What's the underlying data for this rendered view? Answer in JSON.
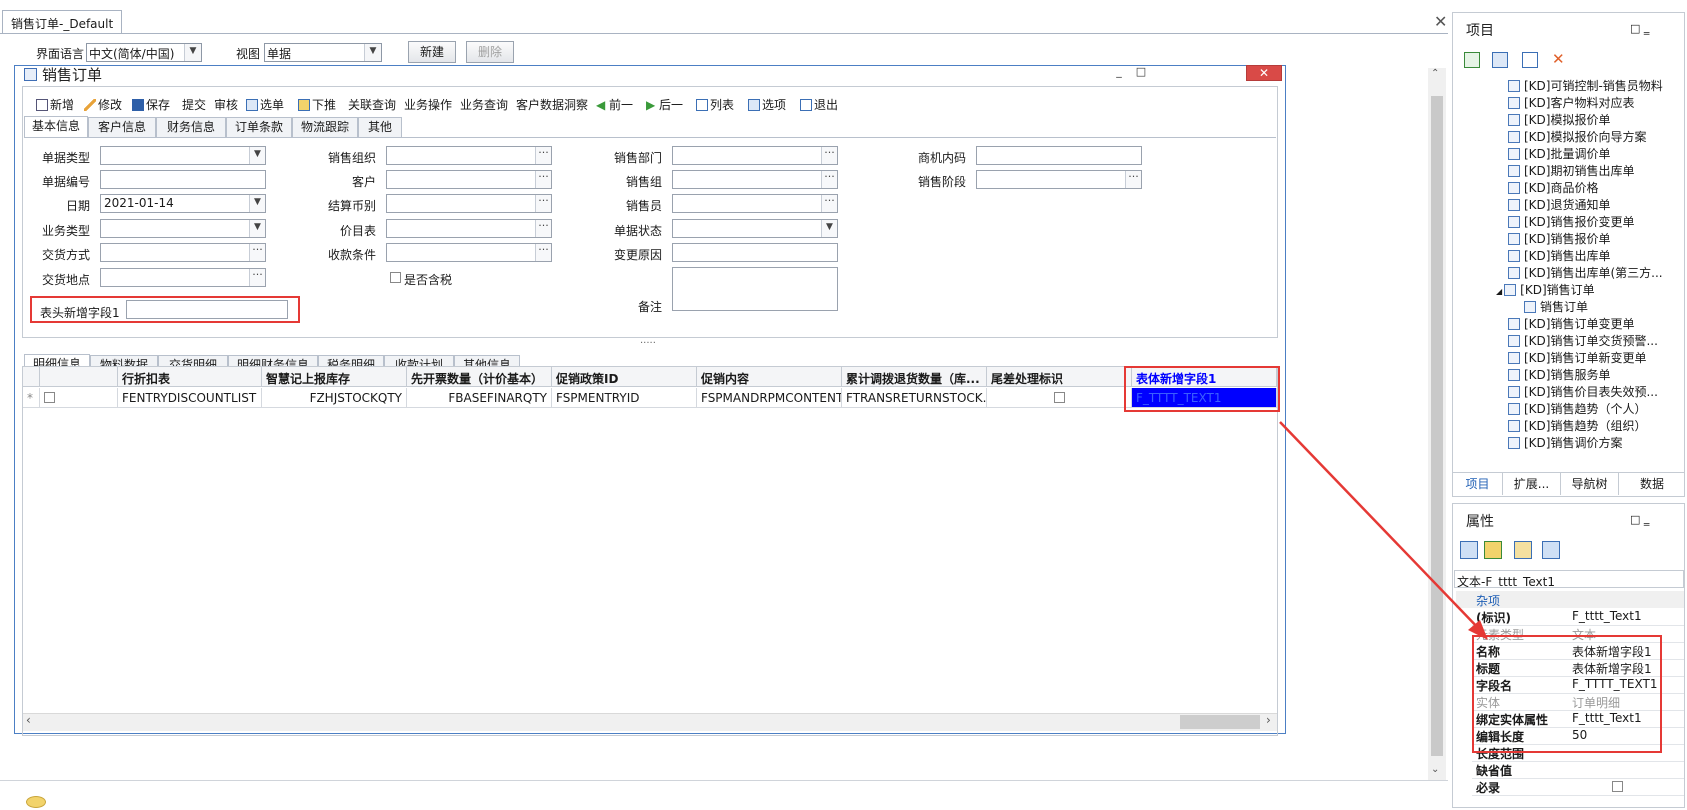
{
  "doc_tab": {
    "label": "销售订单-_Default"
  },
  "designer": {
    "lang_label": "界面语言",
    "lang_value": "中文(简体/中国)",
    "view_label": "视图",
    "view_value": "单据",
    "new_btn": "新建",
    "delete_btn": "删除"
  },
  "form": {
    "title": "销售订单",
    "toolbar": [
      "新增",
      "修改",
      "保存",
      "提交",
      "审核",
      "选单",
      "下推",
      "关联查询",
      "业务操作",
      "业务查询",
      "客户数据洞察",
      "前一",
      "后一",
      "列表",
      "选项",
      "退出"
    ],
    "tabs": [
      "基本信息",
      "客户信息",
      "财务信息",
      "订单条款",
      "物流跟踪",
      "其他"
    ],
    "fields": {
      "bill_type": "单据类型",
      "bill_no": "单据编号",
      "date": "日期",
      "date_value": "2021-01-14",
      "biz_type": "业务类型",
      "delivery_method": "交货方式",
      "delivery_place": "交货地点",
      "sale_org": "销售组织",
      "customer": "客户",
      "currency": "结算币别",
      "price_list": "价目表",
      "pay_terms": "收款条件",
      "tax_incl": "是否含税",
      "sale_dept": "销售部门",
      "sale_group": "销售组",
      "salesman": "销售员",
      "bill_status": "单据状态",
      "change_reason": "变更原因",
      "remark": "备注",
      "opportunity": "商机内码",
      "sale_stage": "销售阶段",
      "header_new_field": "表头新增字段1"
    },
    "splitter": "·····",
    "detail_tabs": [
      "明细信息",
      "物料数据",
      "交货明细",
      "明细财务信息",
      "税务明细",
      "收款计划",
      "其他信息"
    ],
    "grid": {
      "headers": [
        "行折扣表",
        "智慧记上报库存",
        "先开票数量（计价基本）",
        "促销政策ID",
        "促销内容",
        "累计调拨退货数量（库...",
        "尾差处理标识",
        "表体新增字段1"
      ],
      "row": [
        "FENTRYDISCOUNTLIST",
        "FZHJSTOCKQTY",
        "FBASEFINARQTY",
        "FSPMENTRYID",
        "FSPMANDRPMCONTENT",
        "FTRANSRETURNSTOCK...",
        "",
        "F_TTTT_TEXT1"
      ],
      "row_marker": "*"
    }
  },
  "project_panel": {
    "title": "项目",
    "items": [
      "[KD]可销控制-销售员物料",
      "[KD]客户物料对应表",
      "[KD]模拟报价单",
      "[KD]模拟报价向导方案",
      "[KD]批量调价单",
      "[KD]期初销售出库单",
      "[KD]商品价格",
      "[KD]退货通知单",
      "[KD]销售报价变更单",
      "[KD]销售报价单",
      "[KD]销售出库单",
      "[KD]销售出库单(第三方...",
      "[KD]销售订单",
      "销售订单",
      "[KD]销售订单变更单",
      "[KD]销售订单交货预警...",
      "[KD]销售订单新变更单",
      "[KD]销售服务单",
      "[KD]销售价目表失效预...",
      "[KD]销售趋势（个人）",
      "[KD]销售趋势（组织）",
      "[KD]销售调价方案"
    ],
    "tabs": [
      "项目",
      "扩展...",
      "导航树",
      "数据"
    ]
  },
  "props_panel": {
    "title": "属性",
    "object": "文本-F_tttt_Text1",
    "category": "杂项",
    "rows": [
      {
        "k": "(标识)",
        "v": "F_tttt_Text1",
        "dim": false
      },
      {
        "k": "元素类型",
        "v": "文本",
        "dim": true
      },
      {
        "k": "名称",
        "v": "表体新增字段1",
        "dim": false
      },
      {
        "k": "标题",
        "v": "表体新增字段1",
        "dim": false
      },
      {
        "k": "字段名",
        "v": "F_TTTT_TEXT1",
        "dim": false
      },
      {
        "k": "实体",
        "v": "订单明细",
        "dim": true
      },
      {
        "k": "绑定实体属性",
        "v": "F_tttt_Text1",
        "dim": false
      },
      {
        "k": "编辑长度",
        "v": "50",
        "dim": false
      },
      {
        "k": "长度范围",
        "v": "",
        "dim": false
      },
      {
        "k": "缺省值",
        "v": "",
        "dim": false
      },
      {
        "k": "必录",
        "v": "",
        "dim": false
      }
    ]
  },
  "colors": {
    "accent_blue": "#0000ff",
    "highlight_red": "#e53935",
    "canvas_border": "#4c7fc4"
  }
}
